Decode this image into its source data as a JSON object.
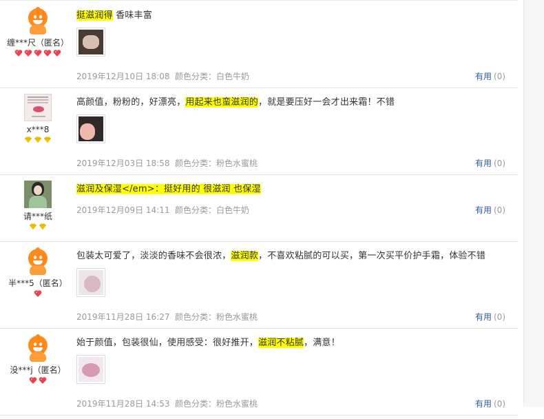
{
  "reviews": [
    {
      "user": "缠***尺（匿名）",
      "badge_type": "heart",
      "badge_count": 5,
      "avatar": "mascot-avatar",
      "text_parts": [
        {
          "t": "挺滋润得",
          "hl": true
        },
        {
          "t": " 香味丰富",
          "hl": false
        }
      ],
      "has_image": true,
      "date": "2019年12月10日 18:08",
      "variant": "颜色分类：白色牛奶",
      "useful_label": "有用",
      "useful_count": "(0)"
    },
    {
      "user": "x***8",
      "badge_type": "diamond",
      "badge_count": 3,
      "avatar": "photo-avatar",
      "text_parts": [
        {
          "t": "高颜值，粉粉的，好漂亮，",
          "hl": false
        },
        {
          "t": "用起来也蛮滋润的",
          "hl": true
        },
        {
          "t": "，就是要压好一会才出来霜！不错",
          "hl": false
        }
      ],
      "has_image": true,
      "date": "2019年12月03日 18:58",
      "variant": "颜色分类：粉色水蜜桃",
      "useful_label": "有用",
      "useful_count": "(0)"
    },
    {
      "user": "请***纸",
      "badge_type": "diamond",
      "badge_count": 2,
      "avatar": "photo-avatar",
      "text_parts": [
        {
          "t": "滋润及保湿</em>：挺好用的 很滋润 也保湿",
          "hl": true
        }
      ],
      "has_image": false,
      "date": "2019年12月09日 14:11",
      "variant": "颜色分类：白色牛奶",
      "useful_label": "有用",
      "useful_count": "(0)"
    },
    {
      "user": "半***5（匿名）",
      "badge_type": "heart",
      "badge_count": 1,
      "avatar": "mascot-avatar",
      "text_parts": [
        {
          "t": "包装太可爱了，淡淡的香味不会很浓，",
          "hl": false
        },
        {
          "t": "滋润款",
          "hl": true
        },
        {
          "t": "，不喜欢粘腻的可以买，第一次买平价护手霜，体验不错",
          "hl": false
        }
      ],
      "has_image": true,
      "date": "2019年11月28日 16:27",
      "variant": "颜色分类：粉色水蜜桃",
      "useful_label": "有用",
      "useful_count": "(0)"
    },
    {
      "user": "没***j（匿名）",
      "badge_type": "heart",
      "badge_count": 2,
      "avatar": "mascot-avatar",
      "text_parts": [
        {
          "t": "始于颜值，包装很仙，使用感受：很好推开，",
          "hl": false
        },
        {
          "t": "滋润不粘腻",
          "hl": true
        },
        {
          "t": "，满意！",
          "hl": false
        }
      ],
      "has_image": true,
      "date": "2019年11月28日 14:53",
      "variant": "颜色分类：粉色水蜜桃",
      "useful_label": "有用",
      "useful_count": "(0)"
    }
  ],
  "colors": {
    "highlight": "#ffff00",
    "useful_link": "#2d5c9e",
    "meta_text": "#9a9a9a",
    "heart_badge": "#e8434f",
    "diamond_badge": "#f2c300"
  }
}
